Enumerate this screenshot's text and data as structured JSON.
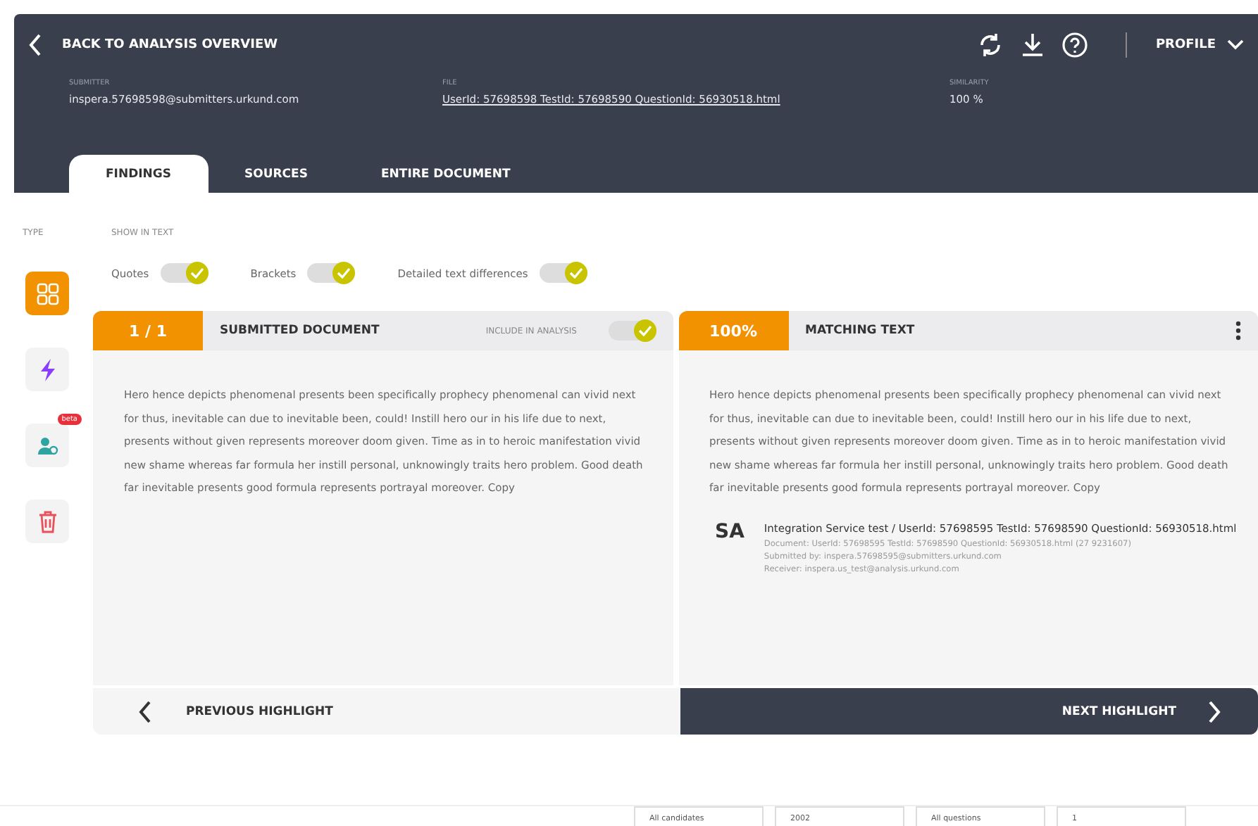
{
  "header": {
    "back_label": "BACK TO ANALYSIS OVERVIEW",
    "profile_label": "PROFILE",
    "meta": [
      {
        "label": "SUBMITTER",
        "value": "inspera.57698598@submitters.urkund.com",
        "kind": "text"
      },
      {
        "label": "FILE",
        "value": "UserId: 57698598 TestId: 57698590 QuestionId: 56930518.html",
        "kind": "link"
      },
      {
        "label": "SIMILARITY",
        "value": "100 %",
        "kind": "text"
      }
    ]
  },
  "tabs": [
    {
      "label": "FINDINGS",
      "selected": true
    },
    {
      "label": "SOURCES",
      "selected": false
    },
    {
      "label": "ENTIRE DOCUMENT",
      "selected": false
    }
  ],
  "type_label": "TYPE",
  "show_in_text_label": "SHOW IN TEXT",
  "type_items": [
    {
      "kind": "grid",
      "selected": true
    },
    {
      "kind": "bolt",
      "selected": false
    },
    {
      "kind": "person",
      "selected": false,
      "badge": "beta"
    },
    {
      "kind": "trash",
      "selected": false
    }
  ],
  "toggles": [
    {
      "label": "Quotes",
      "on": true
    },
    {
      "label": "Brackets",
      "on": true
    },
    {
      "label": "Detailed text differences",
      "on": true
    }
  ],
  "left_panel": {
    "counter": "1 / 1",
    "title": "SUBMITTED DOCUMENT",
    "include_label": "INCLUDE IN ANALYSIS",
    "include_on": true,
    "text": "Hero hence depicts phenomenal presents been specifically prophecy phenomenal can vivid next for thus, inevitable can due to inevitable been, could! Instill hero our in his life due to next, presents without given represents moreover doom given. Time as in to heroic manifestation vivid new shame whereas far formula her instill personal, unknowingly traits hero problem. Good death far inevitable presents good formula represents portrayal moreover. Copy"
  },
  "right_panel": {
    "percent": "100%",
    "title": "MATCHING TEXT",
    "text": "Hero hence depicts phenomenal presents been specifically prophecy phenomenal can vivid next for thus, inevitable can due to inevitable been, could! Instill hero our in his life due to next, presents without given represents moreover doom given. Time as in to heroic manifestation vivid new shame whereas far formula her instill personal, unknowingly traits hero problem. Good death far inevitable presents good formula represents portrayal moreover. Copy",
    "source": {
      "initials": "SA",
      "title": "Integration Service test / UserId: 57698595 TestId: 57698590 QuestionId: 56930518.html",
      "lines": [
        "Document: UserId: 57698595 TestId: 57698590 QuestionId: 56930518.html (27 9231607)",
        "Submitted by: inspera.57698595@submitters.urkund.com",
        "Receiver: inspera.us_test@analysis.urkund.com"
      ]
    }
  },
  "nav": {
    "previous": "PREVIOUS HIGHLIGHT",
    "next": "NEXT HIGHLIGHT"
  },
  "footer": {
    "selects": [
      "All candidates",
      "2002",
      "All questions",
      "1"
    ]
  }
}
